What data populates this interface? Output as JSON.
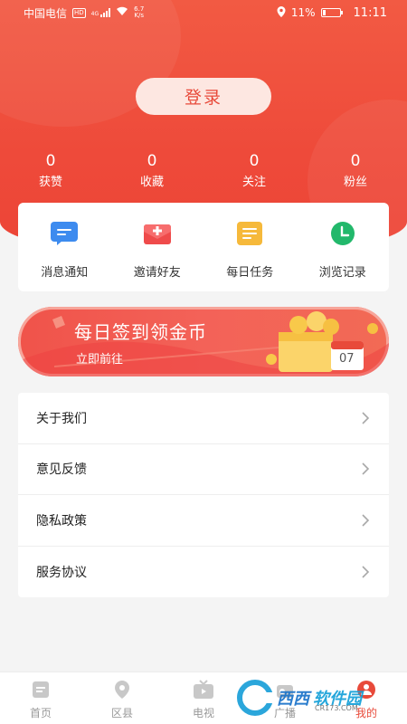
{
  "status_bar": {
    "carrier": "中国电信",
    "hd": "HD",
    "network": "4G",
    "speed_value": "6.7",
    "speed_unit": "K/s",
    "battery": "11%",
    "time": "11:11"
  },
  "header": {
    "login_label": "登录",
    "stats": [
      {
        "value": "0",
        "label": "获赞"
      },
      {
        "value": "0",
        "label": "收藏"
      },
      {
        "value": "0",
        "label": "关注"
      },
      {
        "value": "0",
        "label": "粉丝"
      }
    ]
  },
  "quick_actions": [
    {
      "label": "消息通知",
      "icon": "message-icon",
      "color": "#3d8bef"
    },
    {
      "label": "邀请好友",
      "icon": "invite-icon",
      "color": "#ef4b4b"
    },
    {
      "label": "每日任务",
      "icon": "task-icon",
      "color": "#f6b93b"
    },
    {
      "label": "浏览记录",
      "icon": "history-icon",
      "color": "#22b86b"
    }
  ],
  "banner": {
    "title": "每日签到领金币",
    "subtitle": "立即前往",
    "calendar_day": "07"
  },
  "menu": [
    {
      "label": "关于我们"
    },
    {
      "label": "意见反馈"
    },
    {
      "label": "隐私政策"
    },
    {
      "label": "服务协议"
    }
  ],
  "tabbar": [
    {
      "label": "首页",
      "icon": "home-icon",
      "active": false
    },
    {
      "label": "区县",
      "icon": "location-icon",
      "active": false
    },
    {
      "label": "电视",
      "icon": "tv-icon",
      "active": false
    },
    {
      "label": "广播",
      "icon": "radio-icon",
      "active": false
    },
    {
      "label": "我的",
      "icon": "profile-icon",
      "active": true
    }
  ],
  "watermark": {
    "text1": "西西",
    "text2": "软件园",
    "url": "CR173.COM"
  },
  "colors": {
    "accent": "#e84a3a",
    "header_red": "#ef4c3b"
  }
}
